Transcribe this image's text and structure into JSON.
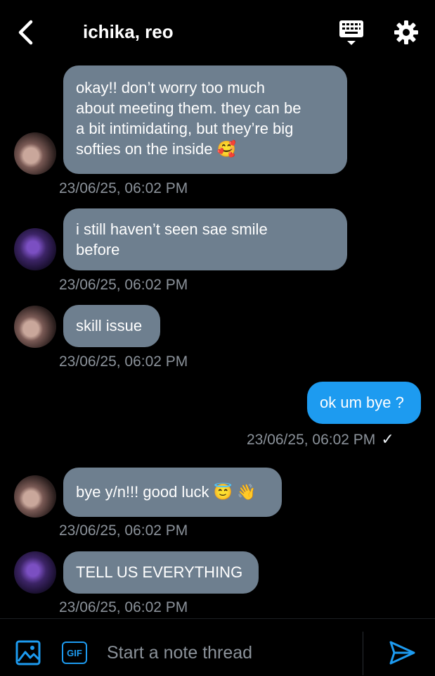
{
  "header": {
    "title": "ichika, reo",
    "back_icon": "chevron-left-icon",
    "keyboard_icon": "keyboard-icon",
    "settings_icon": "gear-icon"
  },
  "messages": [
    {
      "sender": "ichika",
      "direction": "in",
      "text": "okay!! don’t worry too much\nabout meeting them. they can be\na bit intimidating, but they’re big\nsofties on the inside 🥰",
      "timestamp": "23/06/25, 06:02 PM"
    },
    {
      "sender": "reo",
      "direction": "in",
      "text": "i still haven’t seen sae smile\nbefore",
      "timestamp": "23/06/25, 06:02 PM"
    },
    {
      "sender": "ichika",
      "direction": "in",
      "text": "skill issue",
      "timestamp": "23/06/25, 06:02 PM"
    },
    {
      "sender": "me",
      "direction": "out",
      "text": "ok um bye ?",
      "timestamp": "23/06/25, 06:02 PM",
      "status": "✓"
    },
    {
      "sender": "ichika",
      "direction": "in",
      "text": "bye y/n!!! good luck 😇 👋",
      "timestamp": "23/06/25, 06:02 PM"
    },
    {
      "sender": "reo",
      "direction": "in",
      "text": "TELL US EVERYTHING",
      "timestamp": "23/06/25, 06:02 PM"
    }
  ],
  "composer": {
    "placeholder": "Start a note thread",
    "gif_label": "GIF",
    "image_icon": "image-icon",
    "send_icon": "send-icon"
  },
  "colors": {
    "background": "#000000",
    "incoming_bubble": "#6e7f8f",
    "outgoing_bubble": "#1d9bf0",
    "timestamp": "#8b929a",
    "accent": "#1d9bf0"
  }
}
